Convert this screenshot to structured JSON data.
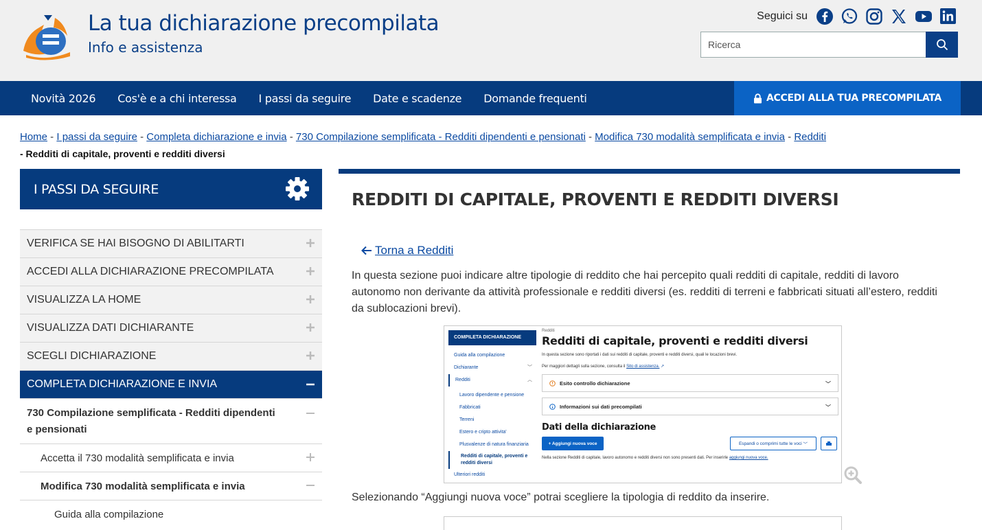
{
  "header": {
    "title": "La tua dichiarazione precompilata",
    "subtitle": "Info e assistenza",
    "social_label": "Seguici su",
    "social_icons": [
      "facebook-icon",
      "whatsapp-icon",
      "instagram-icon",
      "x-icon",
      "youtube-icon",
      "linkedin-icon"
    ],
    "search_placeholder": "Ricerca"
  },
  "nav": {
    "items": [
      "Novità 2026",
      "Cos'è e a chi interessa",
      "I passi da seguire",
      "Date e scadenze",
      "Domande frequenti"
    ],
    "cta": "ACCEDI ALLA TUA PRECOMPILATA"
  },
  "breadcrumb": {
    "links": [
      "Home",
      "I passi da seguire",
      "Completa dichiarazione e invia",
      "730 Compilazione semplificata - Redditi dipendenti e pensionati",
      "Modifica 730 modalità semplificata e invia",
      "Redditi"
    ],
    "sep": " - ",
    "current": "- Redditi di capitale, proventi e redditi diversi"
  },
  "sidebar": {
    "title": "I PASSI DA SEGUIRE",
    "items": [
      "VERIFICA SE HAI BISOGNO DI ABILITARTI",
      "ACCEDI ALLA DICHIARAZIONE PRECOMPILATA",
      "VISUALIZZA LA HOME",
      "VISUALIZZA DATI DICHIARANTE",
      "SCEGLI DICHIARAZIONE",
      "COMPLETA DICHIARAZIONE E INVIA"
    ],
    "sub": "730 Compilazione semplificata - Redditi dipendenti e pensionati",
    "sub2a": "Accetta il 730 modalità semplificata e invia",
    "sub2b": "Modifica 730 modalità semplificata e invia",
    "sub3": "Guida alla compilazione"
  },
  "main": {
    "title": "REDDITI DI CAPITALE, PROVENTI E REDDITI DIVERSI",
    "back": "Torna a Redditi",
    "para": "In questa sezione puoi indicare altre tipologie di reddito che hai percepito quali redditi di capitale, redditi di lavoro autonomo non derivante da attività professionale e redditi diversi (es. redditi di terreni e fabbricati situati all’estero, redditi da sublocazioni brevi).",
    "para2": "Selezionando “Aggiungi nuova voce” potrai scegliere la tipologia di reddito da inserire."
  },
  "shot": {
    "side_title": "COMPILETA DICHIARAZIONE",
    "side_items": [
      "Guida alla compilazione",
      "Dichiarante",
      "Redditi"
    ],
    "side_sub": [
      "Lavoro dipendente e pensione",
      "Fabbricati",
      "Terreni",
      "Estero e cripto attivita'",
      "Plusvalenze di natura finanziaria"
    ],
    "side_hl": "Redditi di capitale, proventi e redditi diversi",
    "side_last": "Ulteriori redditi",
    "crumb": "Redditi",
    "title": "Redditi di capitale, proventi e redditi diversi",
    "p1": "In questa sezione sono riportati i dati sui redditi di capitale, proventi e redditi diversi, quali le locazioni brevi.",
    "p2": "Per maggiori dettagli sulla sezione, consulta il",
    "p2_link": "Sito di assistenza.",
    "acc1": "Esito controllo dichiarazione",
    "acc2": "Informazioni sui dati precompilati",
    "h2": "Dati della dichiarazione",
    "btn_add": "+ Aggiungi nuova voce",
    "btn_expand": "Espandi o comprimi tutte le voci",
    "foot": "Nella sezione Redditi di capitale, lavoro autonomo e redditi diversi non sono presenti dati. Per inserirle",
    "foot_link": "aggiungi nuova voce."
  }
}
